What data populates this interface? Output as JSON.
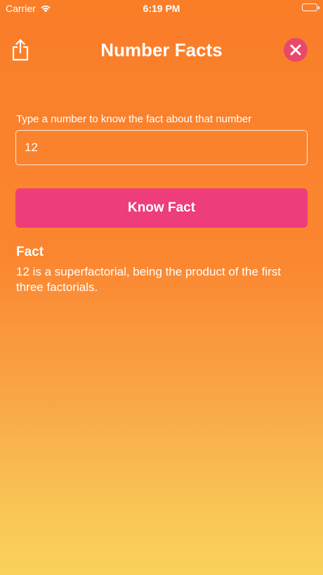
{
  "status_bar": {
    "carrier": "Carrier",
    "time": "6:19 PM"
  },
  "nav": {
    "title": "Number Facts",
    "share_icon": "share-icon",
    "close_icon": "close-icon"
  },
  "form": {
    "prompt": "Type a number to know the fact about that number",
    "input_value": "12",
    "button_label": "Know Fact"
  },
  "result": {
    "heading": "Fact",
    "text": "12 is a superfactorial, being the product of the first three factorials."
  },
  "colors": {
    "gradient_top": "#fa7d28",
    "gradient_bottom": "#f9d25b",
    "button": "#ee3d7b",
    "close_button": "#e8496a"
  }
}
